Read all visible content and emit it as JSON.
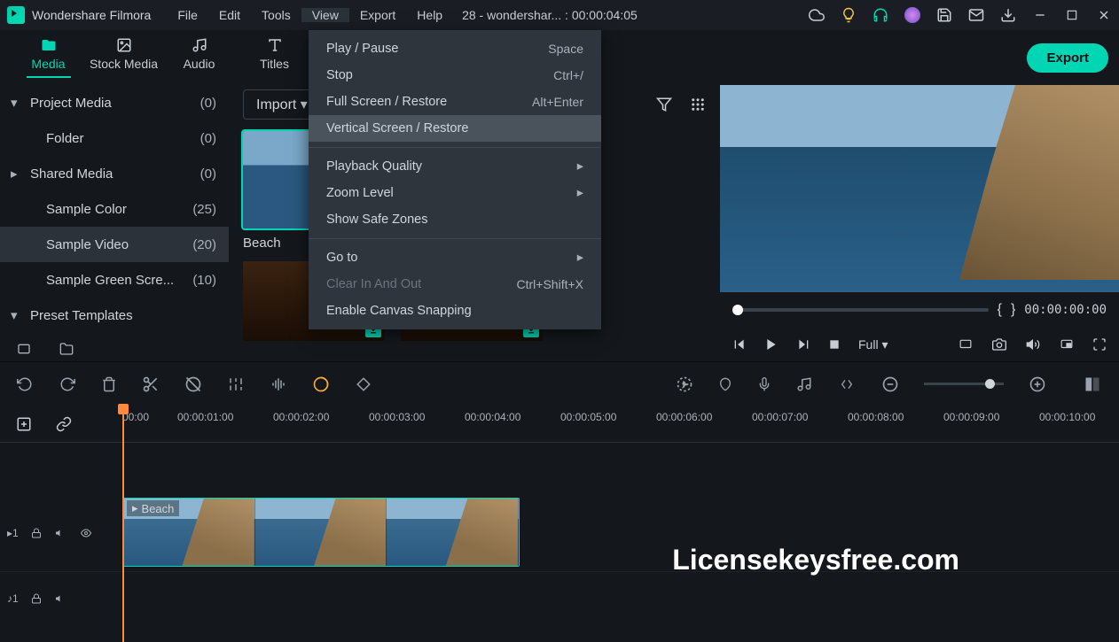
{
  "app": {
    "title": "Wondershare Filmora",
    "project": "28 - wondershar... : 00:00:04:05"
  },
  "menu": {
    "file": "File",
    "edit": "Edit",
    "tools": "Tools",
    "view": "View",
    "export": "Export",
    "help": "Help"
  },
  "dropdown": {
    "play": "Play / Pause",
    "play_sc": "Space",
    "stop": "Stop",
    "stop_sc": "Ctrl+/",
    "full": "Full Screen / Restore",
    "full_sc": "Alt+Enter",
    "vert": "Vertical Screen / Restore",
    "quality": "Playback Quality",
    "zoom": "Zoom Level",
    "safe": "Show Safe Zones",
    "goto": "Go to",
    "clear": "Clear In And Out",
    "clear_sc": "Ctrl+Shift+X",
    "snap": "Enable Canvas Snapping"
  },
  "tabs": {
    "media": "Media",
    "stock": "Stock Media",
    "audio": "Audio",
    "titles": "Titles",
    "export": "Export"
  },
  "sidebar": {
    "project": "Project Media",
    "project_c": "(0)",
    "folder": "Folder",
    "folder_c": "(0)",
    "shared": "Shared Media",
    "shared_c": "(0)",
    "color": "Sample Color",
    "color_c": "(25)",
    "video": "Sample Video",
    "video_c": "(20)",
    "green": "Sample Green Scre...",
    "green_c": "(10)",
    "preset": "Preset Templates"
  },
  "browser": {
    "import": "Import",
    "thumb1": "Beach"
  },
  "preview": {
    "time": "00:00:00:00",
    "full_label": "Full"
  },
  "ruler": [
    "00:00",
    "00:00:01:00",
    "00:00:02:00",
    "00:00:03:00",
    "00:00:04:00",
    "00:00:05:00",
    "00:00:06:00",
    "00:00:07:00",
    "00:00:08:00",
    "00:00:09:00",
    "00:00:10:00"
  ],
  "clip": {
    "name": "Beach"
  },
  "track": {
    "v1": "1",
    "a1": "1"
  },
  "watermark": "Licensekeysfree.com"
}
